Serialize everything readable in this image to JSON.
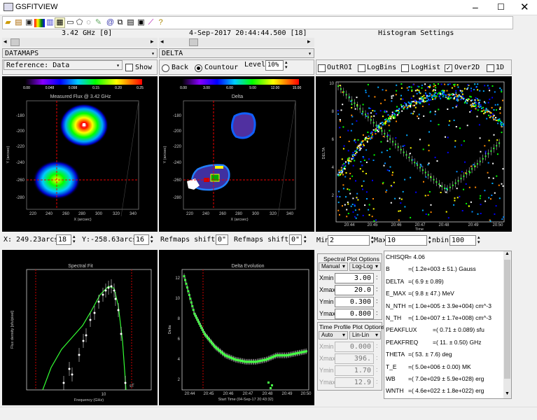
{
  "window": {
    "title": "GSFITVIEW"
  },
  "header": {
    "freq": "3.42 GHz [0]",
    "time": "4-Sep-2017 20:44:44.500 [18]",
    "histogram": "Histogram Settings"
  },
  "selectors": {
    "left": "DATAMAPS",
    "right": "DELTA",
    "reference": "Reference: Data",
    "show": "Show"
  },
  "radio": {
    "back": "Back",
    "contour": "Countour",
    "level_label": "Level",
    "level_value": "10%"
  },
  "hist_opts": {
    "outroi": "OutROI",
    "logbins": "LogBins",
    "loghist": "LogHist",
    "over2d": "Over2D",
    "one_d": "1D"
  },
  "map1": {
    "title": "Measured Flux @ 3.42 GHz",
    "cbar_ticks": [
      "0.00",
      "0.048",
      "0.098",
      "0.15",
      "0.20",
      "0.25"
    ],
    "yticks": [
      "-180",
      "-200",
      "-220",
      "-240",
      "-260",
      "-280"
    ],
    "xticks": [
      "220",
      "240",
      "260",
      "280",
      "300",
      "320",
      "340"
    ],
    "ylabel": "Y (arcsec)",
    "xlabel": "X (arcsec)"
  },
  "map2": {
    "title": "Delta",
    "cbar_ticks": [
      "0.00",
      "3.00",
      "6.00",
      "9.00",
      "12.00",
      "15.00"
    ],
    "yticks": [
      "-180",
      "-200",
      "-220",
      "-240",
      "-260",
      "-280"
    ],
    "xticks": [
      "220",
      "240",
      "260",
      "280",
      "300",
      "320",
      "340"
    ],
    "ylabel": "Y (arcsec)",
    "xlabel": "X (arcsec)"
  },
  "hist": {
    "ylabel": "DELTA",
    "yticks": [
      "10",
      "8",
      "6",
      "4",
      "2"
    ],
    "xticks": [
      "20:44",
      "20:45",
      "20:46",
      "20:47",
      "20:48",
      "20:49",
      "20:50"
    ],
    "xlabel": "Time"
  },
  "coords": {
    "x": "X: 249.23arcsec",
    "x_idx": "18",
    "y": "Y:-258.63arcsec",
    "y_idx": "16",
    "shift_x_label": "Refmaps shift_X:",
    "shift_x": "0\"",
    "shift_y_label": "Refmaps shift_Y:",
    "shift_y": "0\""
  },
  "histrange": {
    "min_label": "Min",
    "min": "2",
    "max_label": "Max",
    "max": "10",
    "nbins_label": "nbins",
    "nbins": "100"
  },
  "spectral": {
    "title": "Spectral Fit",
    "ylabel": "Flux density [sfu/pixel]",
    "xlabel": "Frequency (GHz)",
    "xtick": "10",
    "corner": "sT",
    "chart_data": {
      "type": "scatter",
      "xlabel": "Frequency (GHz)",
      "ylabel": "Flux density [sfu/pixel]",
      "x_ticks_shown": [
        "10"
      ],
      "notes": "Observed flux points with error bars and a green fit curve peaking near 9-10 GHz"
    }
  },
  "delta_evo": {
    "title": "Delta Evolution",
    "ylabel": "Delta",
    "yticks": [
      "12",
      "10",
      "8",
      "6",
      "4",
      "2"
    ],
    "xticks": [
      "20:44",
      "20:45",
      "20:46",
      "20:47",
      "20:48",
      "20:49",
      "20:50"
    ],
    "xlabel": "Start Time (04-Sep-17 20:43:32)",
    "chart_data": {
      "type": "scatter",
      "xlabel": "Start Time (04-Sep-17 20:43:32)",
      "ylabel": "Delta",
      "x": [
        "20:44",
        "20:44:30",
        "20:45",
        "20:45:30",
        "20:46",
        "20:46:30",
        "20:47",
        "20:47:30",
        "20:48",
        "20:48:30",
        "20:49",
        "20:49:30",
        "20:50"
      ],
      "y": [
        12,
        8.5,
        6.6,
        5.4,
        4.6,
        4.2,
        4.0,
        4.0,
        4.2,
        4.6,
        4.6,
        4.8,
        5.0
      ],
      "ylim": [
        1.5,
        12.5
      ]
    }
  },
  "spec_opts": {
    "title": "Spectral Plot Options",
    "mode": "Manual",
    "scale": "Log-Log",
    "rows": [
      {
        "label": "Xmin",
        "value": "3.00"
      },
      {
        "label": "Xmax",
        "value": "20.0"
      },
      {
        "label": "Ymin",
        "value": "0.300"
      },
      {
        "label": "Ymax",
        "value": "0.800"
      }
    ]
  },
  "time_opts": {
    "title": "Time Profile Plot Options",
    "mode": "Auto",
    "scale": "Lin-Lin",
    "rows": [
      {
        "label": "Xmin",
        "value": "0.000"
      },
      {
        "label": "Xmax",
        "value": "396."
      },
      {
        "label": "Ymin",
        "value": "1.70"
      },
      {
        "label": "Ymax",
        "value": "12.9"
      }
    ]
  },
  "fit": {
    "rows": [
      {
        "name": "CHISQR",
        "value": "= 4.06"
      },
      {
        "name": "B",
        "value": "=( 1.2e+003 ± 51.) Gauss"
      },
      {
        "name": "DELTA",
        "value": "=( 6.9 ± 0.89)"
      },
      {
        "name": "E_MAX",
        "value": "=( 9.8 ± 47.) MeV"
      },
      {
        "name": "N_NTH",
        "value": "=( 1.0e+005 ± 3.9e+004) cm^-3"
      },
      {
        "name": "N_TH",
        "value": "=( 1.0e+007 ± 1.7e+008) cm^-3"
      },
      {
        "name": "PEAKFLUX",
        "value": "=( 0.71 ± 0.089) sfu"
      },
      {
        "name": "PEAKFREQ",
        "value": "=( 11. ± 0.50) GHz"
      },
      {
        "name": "THETA",
        "value": "=( 53. ± 7.6) deg"
      },
      {
        "name": "T_E",
        "value": "=( 5.0e+006 ± 0.00) MK"
      },
      {
        "name": "WB",
        "value": "=( 7.0e+029 ± 5.9e+028) erg"
      },
      {
        "name": "WNTH",
        "value": "=( 4.6e+022 ± 1.8e+022) erg"
      }
    ]
  }
}
